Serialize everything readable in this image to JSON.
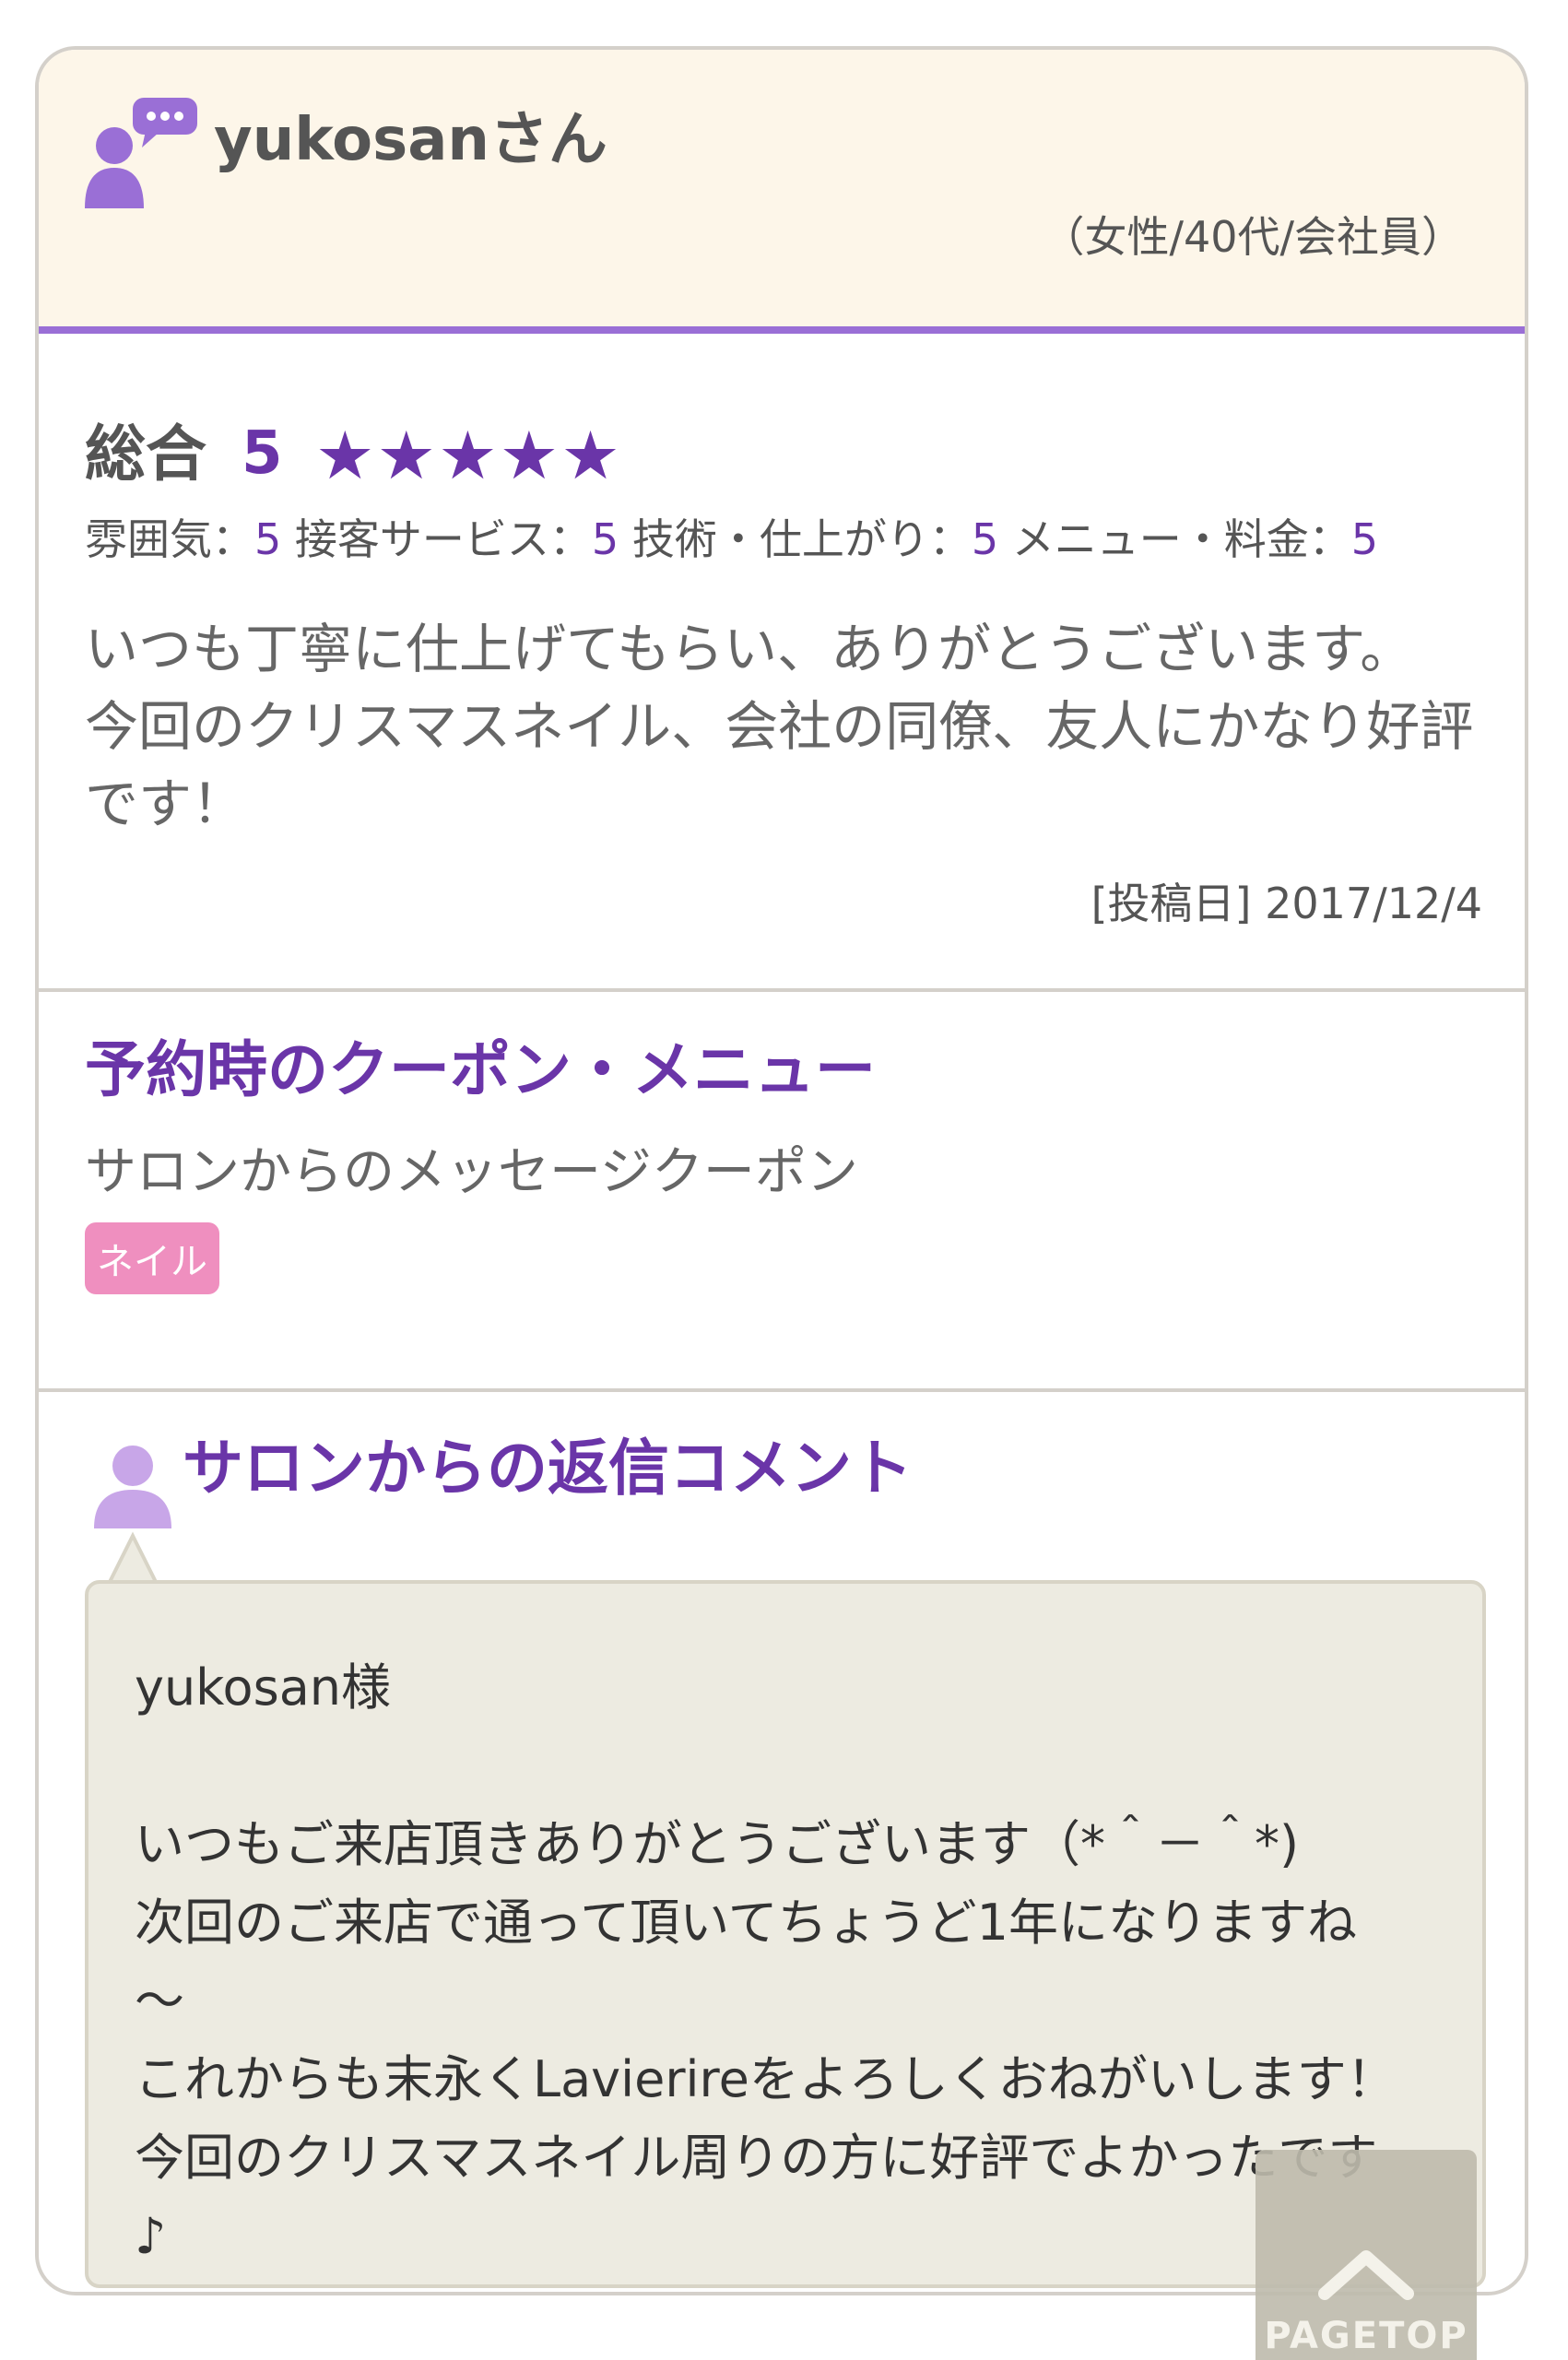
{
  "review": {
    "username": "yukosanさん",
    "profile": "（女性/40代/会社員）",
    "overall_label": "総合",
    "overall_score": "5",
    "stars": [
      "★",
      "★",
      "★",
      "★",
      "★"
    ],
    "ratings": [
      {
        "label": "雰囲気：",
        "value": "5"
      },
      {
        "label": "接客サービス：",
        "value": "5"
      },
      {
        "label": "技術・仕上がり：",
        "value": "5"
      },
      {
        "label": "メニュー・料金：",
        "value": "5"
      }
    ],
    "body_lines": [
      "いつも丁寧に仕上げてもらい、ありがとうございます。",
      "今回のクリスマスネイル、会社の同僚、友人にかなり好評",
      "です！"
    ],
    "post_date": "[投稿日] 2017/12/4"
  },
  "coupon": {
    "heading": "予約時のクーポン・メニュー",
    "name": "サロンからのメッセージクーポン",
    "tag": "ネイル"
  },
  "reply": {
    "heading": "サロンからの返信コメント",
    "text": "yukosan様\n\nいつもご来店頂きありがとうございます（*＾－＾*)\n次回のご来店で通って頂いてちょうど1年になりますね\n～\nこれからも末永くLavierireをよろしくおねがいします！\n今回のクリスマスネイル周りの方に好評でよかったです\n♪"
  },
  "pagetop": {
    "label": "PAGETOP"
  },
  "colors": {
    "accent": "#6a35a8",
    "header_bg": "#fdf6e9",
    "header_border": "#9a6fd6",
    "tag_pink": "#ef8fbf",
    "bubble_bg": "#edebe1"
  }
}
